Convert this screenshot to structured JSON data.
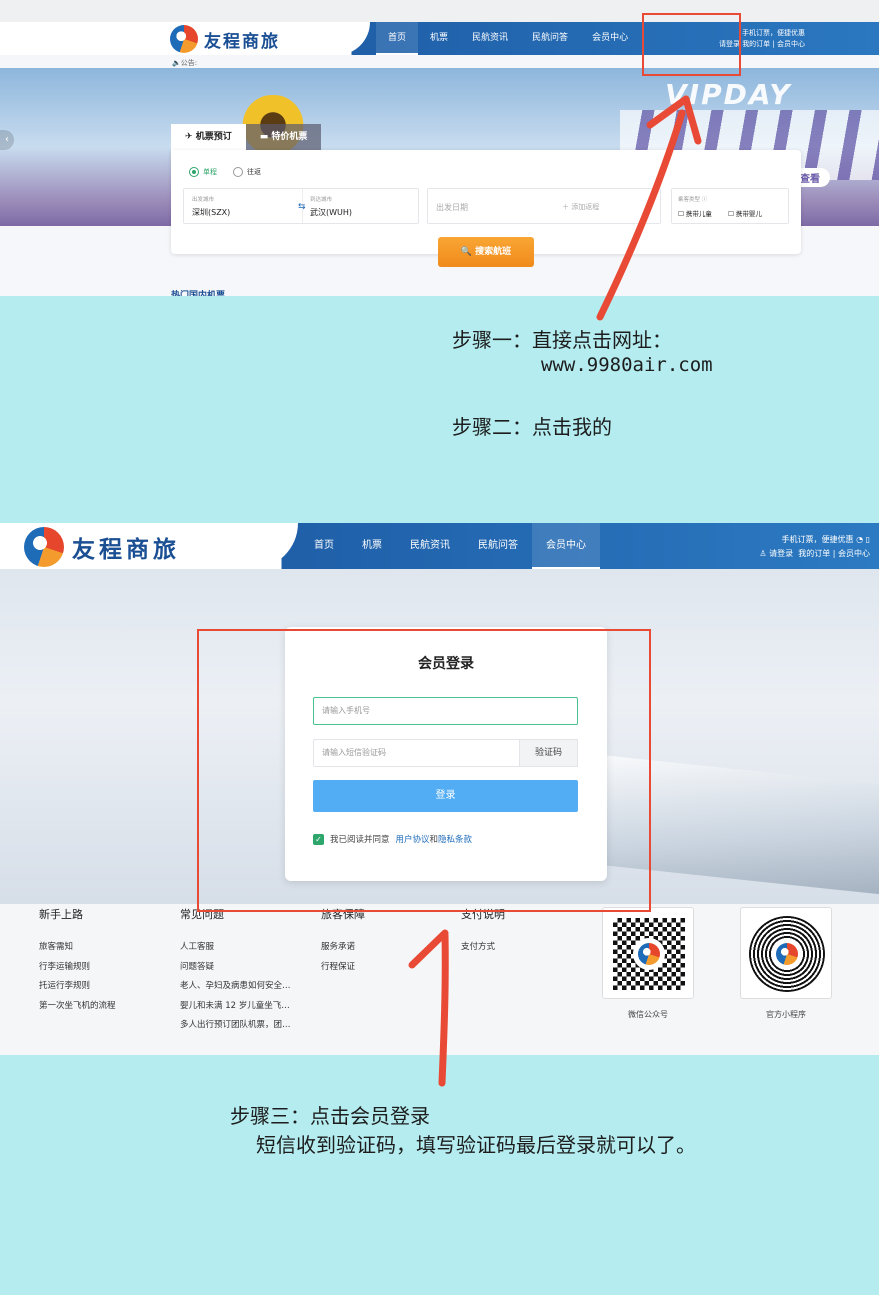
{
  "step1": {
    "brand": "友程商旅",
    "nav": [
      "首页",
      "机票",
      "民航资讯",
      "民航问答",
      "会员中心"
    ],
    "user_top": "手机订票，便捷优惠",
    "user_links": [
      "请登录",
      "我的订单",
      "会员中心"
    ],
    "notice": "公告:",
    "banner_text": "VIPDAY",
    "banner_cta": "查看",
    "tabs": [
      "机票预订",
      "特价机票"
    ],
    "trip_types": [
      "单程",
      "往返"
    ],
    "from_label": "出发城市",
    "from_value": "深圳(SZX)",
    "to_label": "到达城市",
    "to_value": "武汉(WUH)",
    "date_placeholder": "出发日期",
    "add_return": "添加返程",
    "pax_label": "乘客类型",
    "pax_options": [
      "携带儿童",
      "携带婴儿"
    ],
    "search_button": "搜索航班",
    "hot_title": "热门国内机票"
  },
  "instructions": {
    "step1_line1": "步骤一：直接点击网址：",
    "step1_url": "www.9980air.com",
    "step2": "步骤二：点击我的",
    "step3_line1": "步骤三：点击会员登录",
    "step3_line2": "短信收到验证码，填写验证码最后登录就可以了。"
  },
  "step2": {
    "brand": "友程商旅",
    "nav": [
      "首页",
      "机票",
      "民航资讯",
      "民航问答",
      "会员中心"
    ],
    "user_top": "手机订票，便捷优惠",
    "user_links": [
      "请登录",
      "我的订单",
      "会员中心"
    ],
    "login": {
      "title": "会员登录",
      "phone_placeholder": "请输入手机号",
      "code_placeholder": "请输入短信验证码",
      "code_button": "验证码",
      "submit": "登录",
      "agree_text": "我已阅读并同意",
      "terms": "用户协议",
      "and": "和",
      "privacy": "隐私条款"
    },
    "footer_columns": [
      {
        "title": "新手上路",
        "items": [
          "旅客需知",
          "行李运输规则",
          "托运行李规则",
          "第一次坐飞机的流程"
        ]
      },
      {
        "title": "常见问题",
        "items": [
          "人工客服",
          "问题答疑",
          "老人、孕妇及病患如何安全…",
          "婴儿和未满 12 岁儿童坐飞…",
          "多人出行预订团队机票，团…"
        ]
      },
      {
        "title": "旅客保障",
        "items": [
          "服务承诺",
          "行程保证"
        ]
      },
      {
        "title": "支付说明",
        "items": [
          "支付方式"
        ]
      }
    ],
    "qr_labels": [
      "微信公众号",
      "官方小程序"
    ]
  }
}
